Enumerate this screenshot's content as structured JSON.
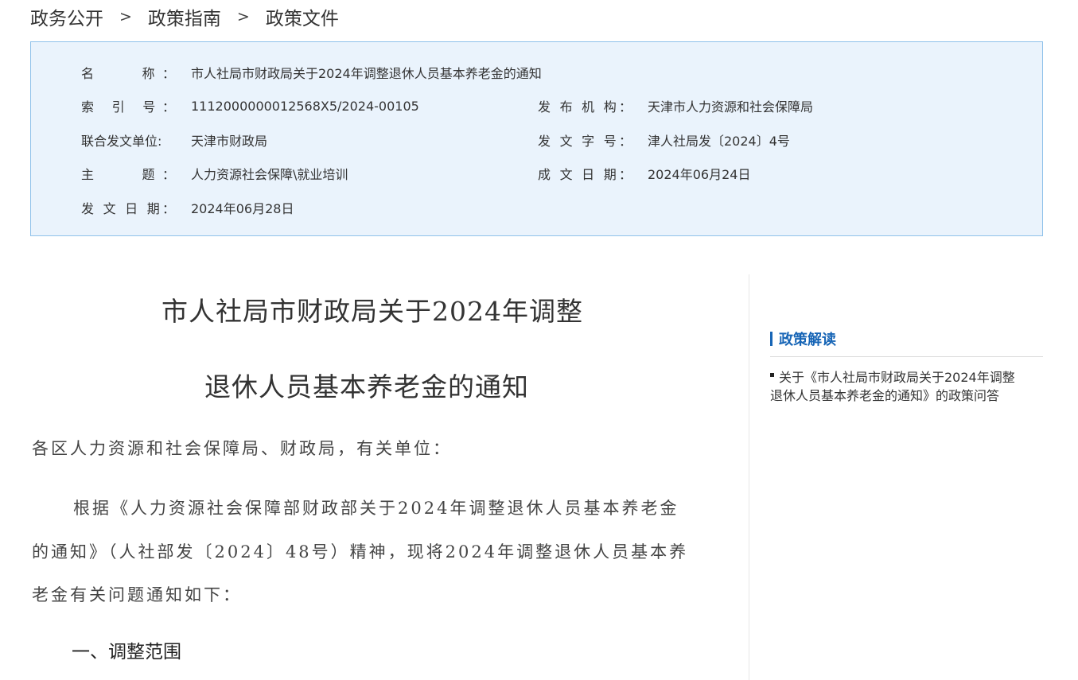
{
  "breadcrumb": {
    "items": [
      "政务公开",
      "政策指南",
      "政策文件"
    ],
    "separator": ">"
  },
  "meta": {
    "name_label": "名　　称：",
    "name_value": "市人社局市财政局关于2024年调整退休人员基本养老金的通知",
    "index_label": "索 引 号：",
    "index_value": "1112000000012568X5/2024-00105",
    "issuer_label": "发 布 机 构：",
    "issuer_value": "天津市人力资源和社会保障局",
    "joint_label": "联合发文单位:",
    "joint_value": "天津市财政局",
    "docno_label": "发 文 字 号：",
    "docno_value": "津人社局发〔2024〕4号",
    "subject_label": "主　　题：",
    "subject_value": "人力资源社会保障\\就业培训",
    "written_label": "成 文 日 期：",
    "written_value": "2024年06月24日",
    "publish_label": "发 文 日 期：",
    "publish_value": "2024年06月28日"
  },
  "article": {
    "title_line1": "市人社局市财政局关于2024年调整",
    "title_line2": "退休人员基本养老金的通知",
    "salutation": "各区人力资源和社会保障局、财政局，有关单位：",
    "body_line1": "根据《人力资源社会保障部财政部关于2024年调整退休人员基本养老金",
    "body_line2": "的通知》（人社部发〔2024〕48号）精神，现将2024年调整退休人员基本养",
    "body_line3": "老金有关问题通知如下：",
    "section1": "一、调整范围"
  },
  "sidebar": {
    "title": "政策解读",
    "item_line1": "关于《市人社局市财政局关于2024年调整",
    "item_line2": "退休人员基本养老金的通知》的政策问答"
  },
  "colors": {
    "meta_bg": "#eaf3fc",
    "meta_border": "#8fc1ea",
    "accent": "#1765b6"
  }
}
